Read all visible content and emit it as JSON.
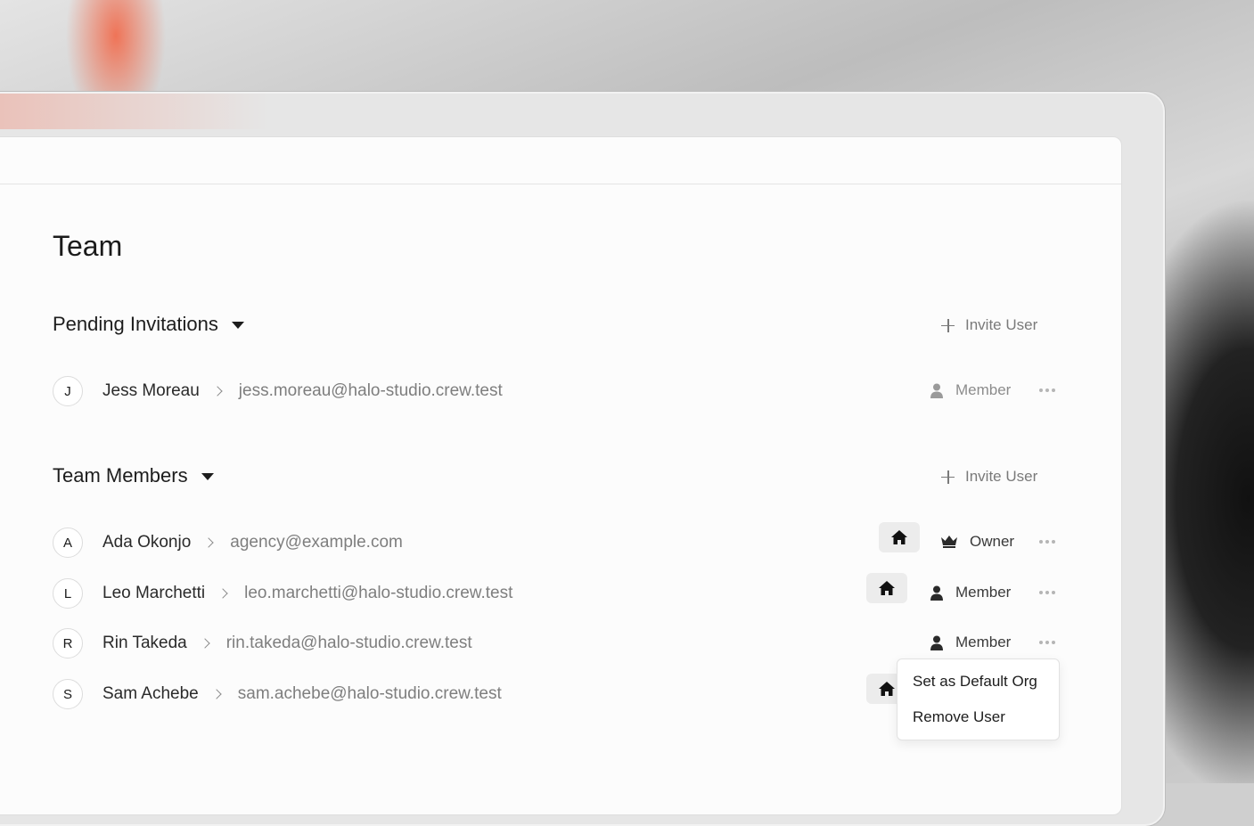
{
  "page": {
    "title": "Team"
  },
  "pending": {
    "title": "Pending Invitations",
    "invite_label": "Invite User",
    "rows": [
      {
        "initial": "J",
        "name": "Jess Moreau",
        "email": "jess.moreau@halo-studio.crew.test",
        "role": "Member",
        "role_icon": "person-icon",
        "default_org": false
      }
    ]
  },
  "members": {
    "title": "Team Members",
    "invite_label": "Invite User",
    "rows": [
      {
        "initial": "A",
        "name": "Ada Okonjo",
        "email": "agency@example.com",
        "role": "Owner",
        "role_icon": "crown-icon",
        "default_org": true
      },
      {
        "initial": "L",
        "name": "Leo Marchetti",
        "email": "leo.marchetti@halo-studio.crew.test",
        "role": "Member",
        "role_icon": "person-icon",
        "default_org": true
      },
      {
        "initial": "R",
        "name": "Rin Takeda",
        "email": "rin.takeda@halo-studio.crew.test",
        "role": "Member",
        "role_icon": "person-icon",
        "default_org": false
      },
      {
        "initial": "S",
        "name": "Sam Achebe",
        "email": "sam.achebe@halo-studio.crew.test",
        "role": "",
        "role_icon": "",
        "default_org": true
      }
    ]
  },
  "context_menu": {
    "items": [
      {
        "label": "Set as Default Org"
      },
      {
        "label": "Remove User"
      }
    ]
  }
}
